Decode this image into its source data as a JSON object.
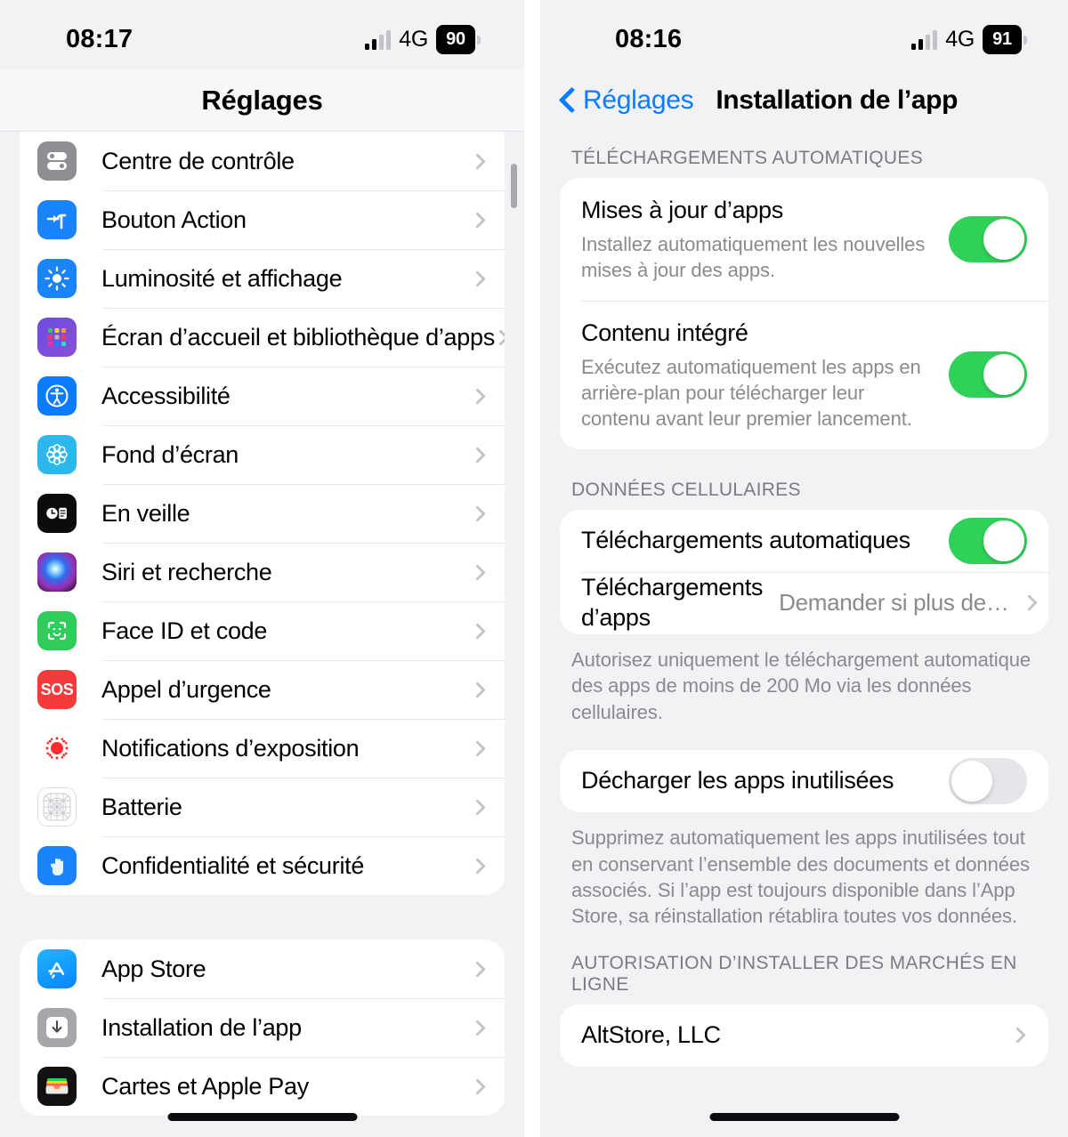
{
  "left": {
    "status": {
      "time": "08:17",
      "network": "4G",
      "battery": "90",
      "signal_icon": "cellular-bars-icon"
    },
    "navbar": {
      "title": "Réglages"
    },
    "groups": [
      {
        "items": [
          {
            "label": "Centre de contrôle",
            "icon": "control-center-icon"
          },
          {
            "label": "Bouton Action",
            "icon": "action-button-icon"
          },
          {
            "label": "Luminosité et affichage",
            "icon": "brightness-display-icon"
          },
          {
            "label": "Écran d’accueil et bibliothèque d’apps",
            "icon": "home-screen-icon"
          },
          {
            "label": "Accessibilité",
            "icon": "accessibility-icon"
          },
          {
            "label": "Fond d’écran",
            "icon": "wallpaper-icon"
          },
          {
            "label": "En veille",
            "icon": "standby-icon"
          },
          {
            "label": "Siri et recherche",
            "icon": "siri-icon"
          },
          {
            "label": "Face ID et code",
            "icon": "face-id-icon"
          },
          {
            "label": "Appel d’urgence",
            "icon": "sos-icon",
            "icon_text": "SOS"
          },
          {
            "label": "Notifications d’exposition",
            "icon": "exposure-notifications-icon"
          },
          {
            "label": "Batterie",
            "icon": "battery-icon"
          },
          {
            "label": "Confidentialité et sécurité",
            "icon": "privacy-security-icon"
          }
        ]
      },
      {
        "items": [
          {
            "label": "App Store",
            "icon": "app-store-icon"
          },
          {
            "label": "Installation de l’app",
            "icon": "app-installation-icon"
          },
          {
            "label": "Cartes et Apple Pay",
            "icon": "wallet-apple-pay-icon"
          }
        ]
      }
    ]
  },
  "right": {
    "status": {
      "time": "08:16",
      "network": "4G",
      "battery": "91",
      "signal_icon": "cellular-bars-icon"
    },
    "navbar": {
      "back_label": "Réglages",
      "title": "Installation de l’app",
      "back_icon": "chevron-left-icon"
    },
    "sections": [
      {
        "header": "TÉLÉCHARGEMENTS AUTOMATIQUES",
        "rows": [
          {
            "title": "Mises à jour d’apps",
            "subtitle": "Installez automatiquement les nouvelles mises à jour des apps.",
            "toggle": "on"
          },
          {
            "title": "Contenu intégré",
            "subtitle": "Exécutez automatiquement les apps en arrière-plan pour télécharger leur contenu avant leur premier lancement.",
            "toggle": "on"
          }
        ]
      },
      {
        "header": "DONNÉES CELLULAIRES",
        "rows": [
          {
            "title": "Téléchargements automatiques",
            "toggle": "on"
          },
          {
            "title": "Téléchargements d’apps",
            "value": "Demander si plus de…",
            "chevron": true
          }
        ],
        "footnote": "Autorisez uniquement le téléchargement automatique des apps de moins de 200 Mo via les données cellulaires."
      },
      {
        "header": "",
        "rows": [
          {
            "title": "Décharger les apps inutilisées",
            "toggle": "off"
          }
        ],
        "footnote": "Supprimez automatiquement les apps inutilisées tout en conservant l’ensemble des documents et données associés. Si l’app est toujours disponible dans l’App Store, sa réinstallation rétablira toutes vos données."
      },
      {
        "header": "AUTORISATION D’INSTALLER DES MARCHÉS EN LIGNE",
        "rows": [
          {
            "title": "AltStore, LLC",
            "chevron": true
          }
        ]
      }
    ]
  },
  "colors": {
    "accent_blue": "#0a7cff",
    "toggle_on_green": "#30d158",
    "toggle_off_gray": "#e6e5ea",
    "background": "#f2f1f4",
    "card": "#ffffff",
    "secondary_text": "#8a8a8f"
  }
}
